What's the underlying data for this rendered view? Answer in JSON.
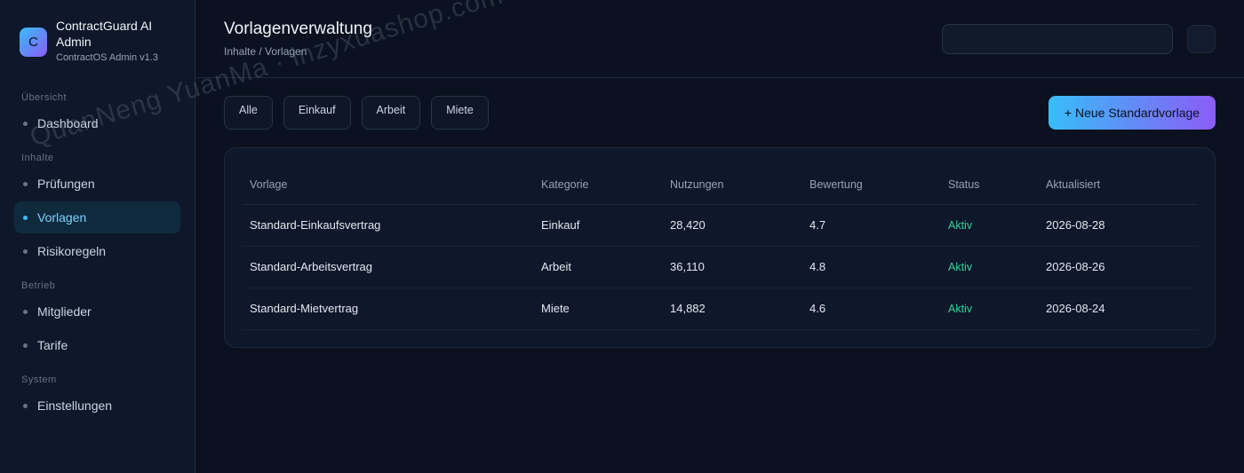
{
  "brand": {
    "logo_letter": "C",
    "name": "ContractGuard AI Admin",
    "subtitle": "ContractOS Admin v1.3"
  },
  "sidebar": {
    "sections": [
      {
        "label": "Übersicht",
        "items": [
          {
            "label": "Dashboard",
            "active": false
          }
        ]
      },
      {
        "label": "Inhalte",
        "items": [
          {
            "label": "Prüfungen",
            "active": false
          },
          {
            "label": "Vorlagen",
            "active": true
          },
          {
            "label": "Risikoregeln",
            "active": false
          }
        ]
      },
      {
        "label": "Betrieb",
        "items": [
          {
            "label": "Mitglieder",
            "active": false
          },
          {
            "label": "Tarife",
            "active": false
          }
        ]
      },
      {
        "label": "System",
        "items": [
          {
            "label": "Einstellungen",
            "active": false
          }
        ]
      }
    ]
  },
  "header": {
    "title": "Vorlagenverwaltung",
    "breadcrumb": "Inhalte / Vorlagen",
    "search_value": ""
  },
  "filters": [
    "Alle",
    "Einkauf",
    "Arbeit",
    "Miete"
  ],
  "new_template_button": "+ Neue Standardvorlage",
  "table": {
    "columns": [
      "Vorlage",
      "Kategorie",
      "Nutzungen",
      "Bewertung",
      "Status",
      "Aktualisiert"
    ],
    "rows": [
      [
        "Standard-Einkaufsvertrag",
        "Einkauf",
        "28,420",
        "4.7",
        "Aktiv",
        "2026-08-28"
      ],
      [
        "Standard-Arbeitsvertrag",
        "Arbeit",
        "36,110",
        "4.8",
        "Aktiv",
        "2026-08-26"
      ],
      [
        "Standard-Mietvertrag",
        "Miete",
        "14,882",
        "4.6",
        "Aktiv",
        "2026-08-24"
      ]
    ]
  },
  "watermark": "QuanNeng YuanMa · inzyxuashop.com",
  "colors": {
    "accent_start": "#38bdf8",
    "accent_end": "#8b5cf6",
    "status_active": "#34d399",
    "background": "#0b1120"
  }
}
